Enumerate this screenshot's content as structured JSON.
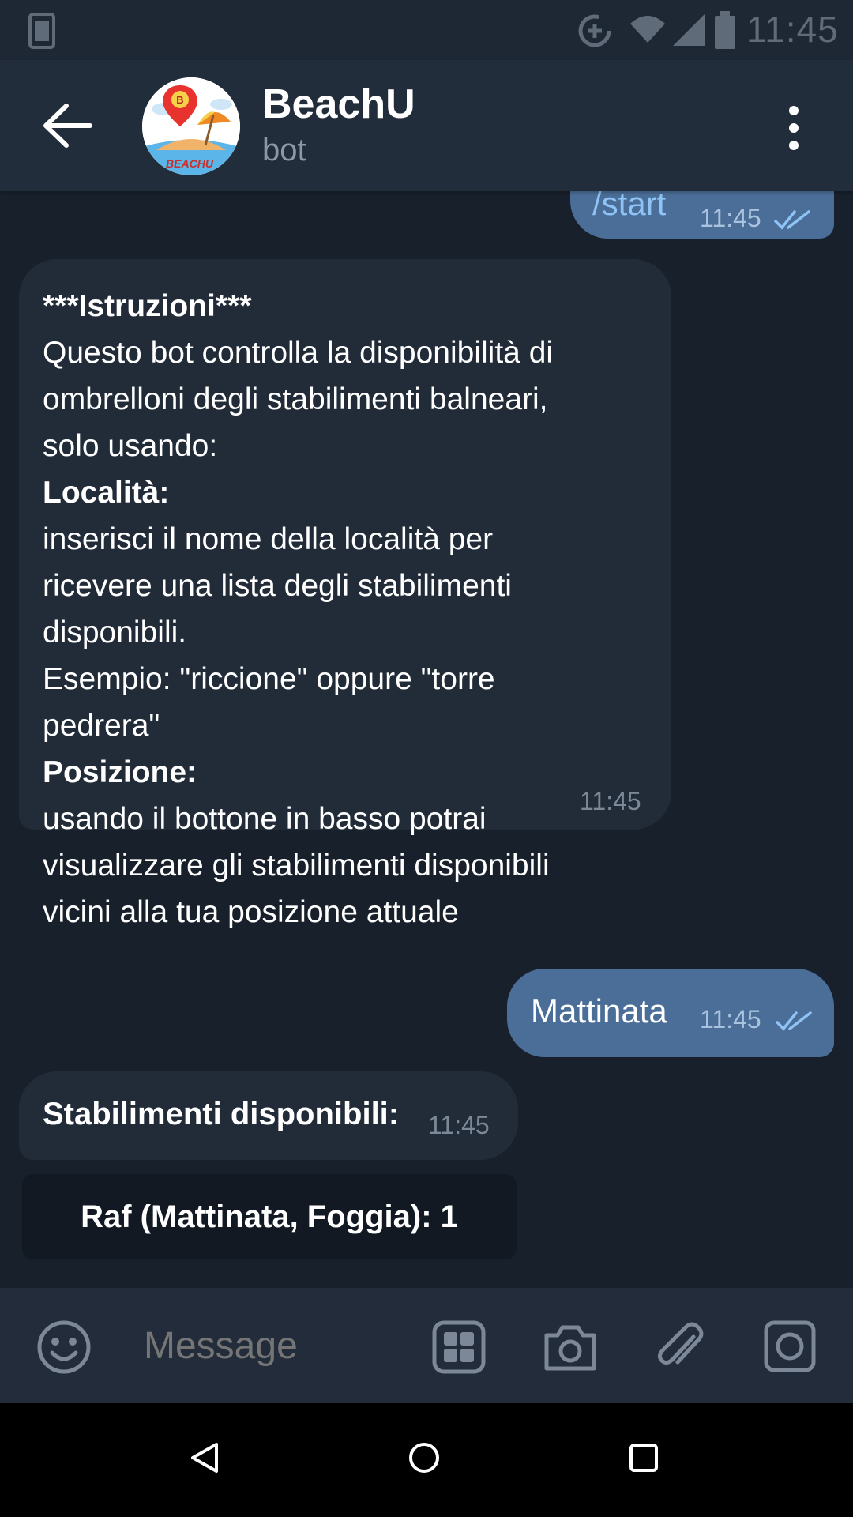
{
  "status_bar": {
    "time": "11:45",
    "icons": [
      "phone-icon",
      "data-saver-icon",
      "wifi-icon",
      "signal-icon",
      "battery-icon"
    ]
  },
  "header": {
    "title": "BeachU",
    "subtitle": "bot",
    "avatar_text": "BEACHU",
    "avatar_badge": "B",
    "icons": [
      "back-arrow-icon",
      "more-vertical-icon"
    ]
  },
  "messages": [
    {
      "direction": "outgoing",
      "text": "/start",
      "time": "11:45",
      "status": "read"
    },
    {
      "direction": "incoming",
      "lines": [
        {
          "text": "***Istruzioni***",
          "bold": true
        },
        {
          "text": "Questo bot controlla la disponibilità di",
          "bold": false
        },
        {
          "text": "ombrelloni degli stabilimenti balneari,",
          "bold": false
        },
        {
          "text": "solo usando:",
          "bold": false
        },
        {
          "text": "Località:",
          "bold": true
        },
        {
          "text": "inserisci il nome della località per",
          "bold": false
        },
        {
          "text": "ricevere una lista degli stabilimenti",
          "bold": false
        },
        {
          "text": "disponibili.",
          "bold": false
        },
        {
          "text": "Esempio: \"riccione\" oppure \"torre",
          "bold": false
        },
        {
          "text": "pedrera\"",
          "bold": false
        },
        {
          "text": "Posizione:",
          "bold": true
        },
        {
          "text": "usando il bottone in basso potrai",
          "bold": false
        },
        {
          "text": "visualizzare gli stabilimenti disponibili",
          "bold": false
        },
        {
          "text": "vicini alla tua posizione attuale",
          "bold": false
        }
      ],
      "time": "11:45"
    },
    {
      "direction": "outgoing",
      "text": "Mattinata",
      "time": "11:45",
      "status": "read"
    },
    {
      "direction": "incoming",
      "text": "Stabilimenti disponibili:",
      "time": "11:45"
    }
  ],
  "inline_buttons": [
    {
      "label": "Raf (Mattinata, Foggia): 1"
    }
  ],
  "input_bar": {
    "placeholder": "Message",
    "icons": [
      "emoji-icon",
      "bot-commands-icon",
      "camera-icon",
      "attach-icon",
      "video-message-icon"
    ]
  },
  "nav_bar": {
    "icons": [
      "nav-back-icon",
      "nav-home-icon",
      "nav-recents-icon"
    ]
  },
  "colors": {
    "outgoing_bubble": "#4a6e98",
    "incoming_bubble": "#222c39",
    "background": "#18202b",
    "header": "#222d3b",
    "read_ticks": "#8fc2f5"
  }
}
